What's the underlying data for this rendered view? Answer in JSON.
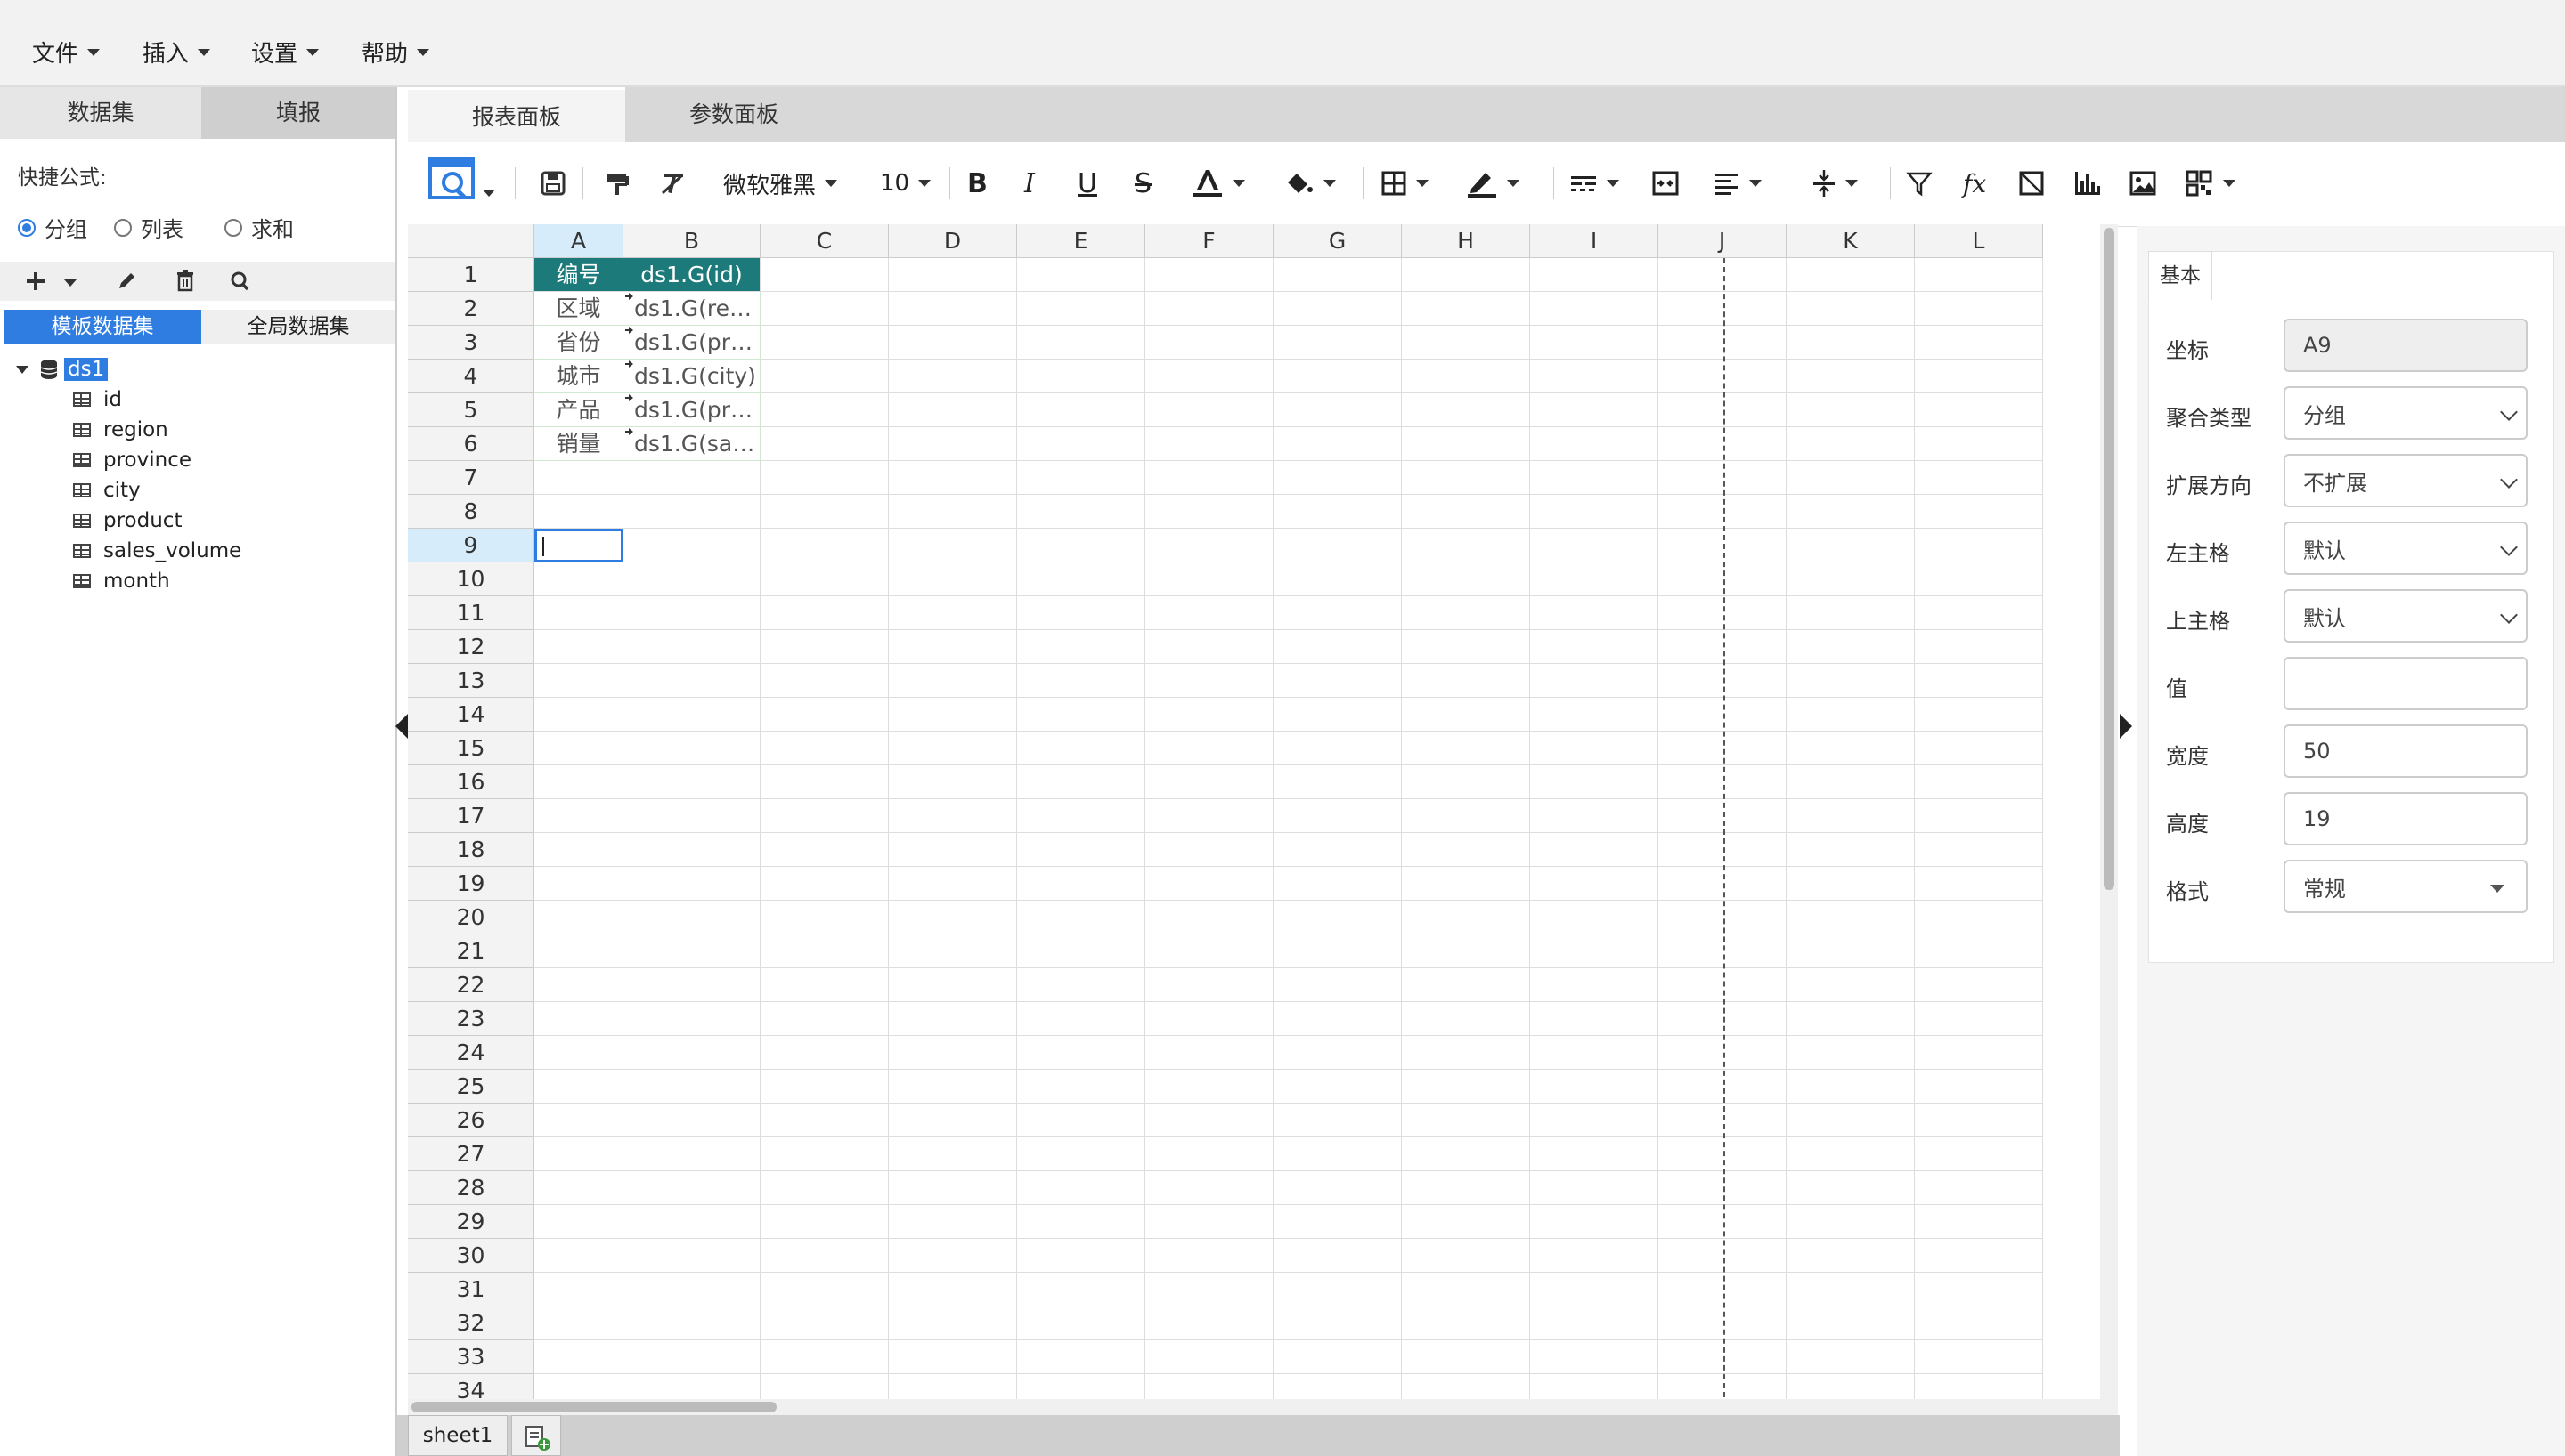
{
  "menubar": {
    "items": [
      "文件",
      "插入",
      "设置",
      "帮助"
    ]
  },
  "left_panel": {
    "tabs": [
      "数据集",
      "填报"
    ],
    "shortcut_label": "快捷公式:",
    "radios": [
      {
        "label": "分组",
        "checked": true
      },
      {
        "label": "列表",
        "checked": false
      },
      {
        "label": "求和",
        "checked": false
      }
    ],
    "dataset_tabs": [
      "模板数据集",
      "全局数据集"
    ],
    "tree": {
      "root": "ds1",
      "fields": [
        "id",
        "region",
        "province",
        "city",
        "product",
        "sales_volume",
        "month"
      ]
    }
  },
  "main_tabs": [
    "报表面板",
    "参数面板"
  ],
  "toolbar": {
    "font_family": "微软雅黑",
    "font_size": "10"
  },
  "grid": {
    "columns": [
      "A",
      "B",
      "C",
      "D",
      "E",
      "F",
      "G",
      "H",
      "I",
      "J",
      "K",
      "L"
    ],
    "rows": [
      "1",
      "2",
      "3",
      "4",
      "5",
      "6",
      "7",
      "8",
      "9",
      "10",
      "11",
      "12",
      "13",
      "14",
      "15",
      "16",
      "17",
      "18",
      "19",
      "20",
      "21",
      "22",
      "23",
      "24",
      "25",
      "26",
      "27",
      "28",
      "29",
      "30",
      "31",
      "32",
      "33",
      "34"
    ],
    "cells": {
      "A1": "编号",
      "B1": "ds1.G(id)",
      "A2": "区域",
      "B2": "ds1.G(re…",
      "A3": "省份",
      "B3": "ds1.G(pr…",
      "A4": "城市",
      "B4": "ds1.G(city)",
      "A5": "产品",
      "B5": "ds1.G(pr…",
      "A6": "销量",
      "B6": "ds1.G(sa…"
    },
    "selected_cell": "A9"
  },
  "sheet_tabs": [
    "sheet1"
  ],
  "right_panel": {
    "tab": "基本",
    "fields": [
      {
        "label": "坐标",
        "value": "A9"
      },
      {
        "label": "聚合类型",
        "value": "分组"
      },
      {
        "label": "扩展方向",
        "value": "不扩展"
      },
      {
        "label": "左主格",
        "value": "默认"
      },
      {
        "label": "上主格",
        "value": "默认"
      },
      {
        "label": "值",
        "value": ""
      },
      {
        "label": "宽度",
        "value": "50"
      },
      {
        "label": "高度",
        "value": "19"
      },
      {
        "label": "格式",
        "value": "常规"
      }
    ]
  },
  "colors": {
    "accent": "#2f7de1",
    "header_cell": "#1d7a7a",
    "selected_tab": "#2f7de1"
  }
}
